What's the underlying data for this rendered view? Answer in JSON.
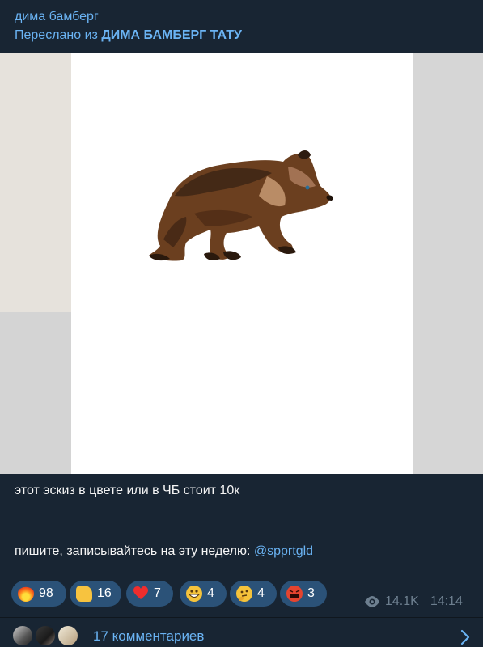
{
  "post": {
    "author": "дима бамберг",
    "forwarded_prefix": "Переслано из ",
    "forwarded_source": "ДИМА БАМБЕРГ ТАТУ",
    "caption_line1": "этот эскиз в цвете или в ЧБ стоит 10к",
    "caption_line2_prefix": "пишите, записывайтесь на эту неделю: ",
    "caption_mention": "@spprtgld",
    "views": "14.1K",
    "time": "14:14"
  },
  "reactions": [
    {
      "icon": "fire-emoji",
      "count": "98"
    },
    {
      "icon": "thumbs-up-emoji",
      "count": "16"
    },
    {
      "icon": "heart-emoji",
      "count": "7"
    },
    {
      "icon": "grin-emoji",
      "count": "4"
    },
    {
      "icon": "thinking-emoji",
      "count": "4"
    },
    {
      "icon": "angry-cursing-emoji",
      "count": "3"
    }
  ],
  "comments": {
    "label": "17 комментариев"
  },
  "colors": {
    "background": "#182533",
    "accent": "#6ab3f3",
    "reaction_bg": "#2b5278",
    "meta": "#6d7f8f"
  }
}
